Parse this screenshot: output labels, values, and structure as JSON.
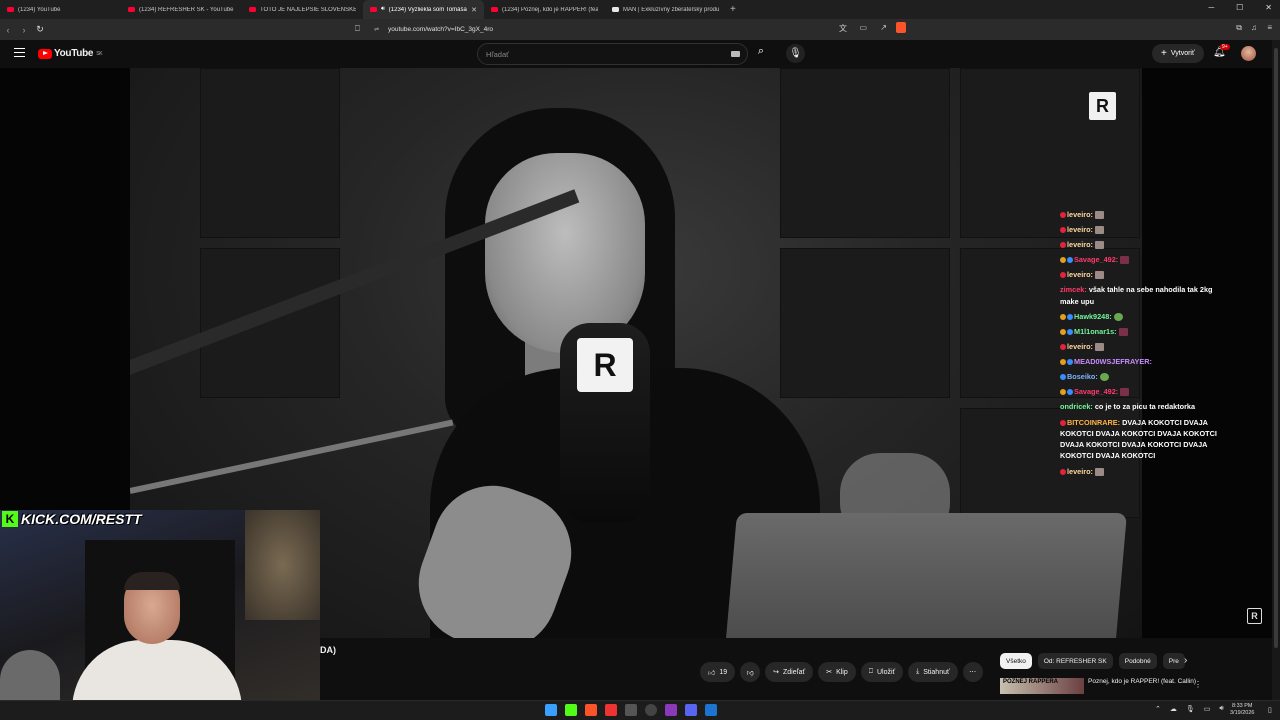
{
  "browser": {
    "tabs": [
      {
        "title": "(1234) YouTube",
        "fav": "youtube"
      },
      {
        "title": "(1234) REFRESHER SK - YouTube",
        "fav": "youtube"
      },
      {
        "title": "TOTO JE NAJLEPŠIE SLOVENSKÉ UMI",
        "fav": "youtube"
      },
      {
        "title": "(1234) Vyzliekla som Tomáša",
        "fav": "youtube",
        "active": true
      },
      {
        "title": "(1234) Poznej, kdo je RAPPER! (feat.",
        "fav": "youtube"
      },
      {
        "title": "MAN | Exkluzívny zberateľský produ",
        "fav": "page"
      }
    ],
    "url": "youtube.com/watch?v=IbC_3gX_4ro"
  },
  "youtube": {
    "logo": "YouTube",
    "region": "SK",
    "search_placeholder": "Hľadať",
    "create_label": "Vytvoriť",
    "notif_count": "9+"
  },
  "chat": [
    {
      "user": "leveiro:",
      "color": "#ffd8a0",
      "text": "",
      "emote": "gray",
      "badge": "red"
    },
    {
      "user": "leveiro:",
      "color": "#ffd8a0",
      "text": "",
      "emote": "gray",
      "badge": "red"
    },
    {
      "user": "leveiro:",
      "color": "#ffd8a0",
      "text": "",
      "emote": "gray",
      "badge": "red"
    },
    {
      "user": "Savage_492:",
      "color": "#ff3b6b",
      "text": "",
      "emote": "pink",
      "badge": "multi"
    },
    {
      "user": "leveiro:",
      "color": "#ffd8a0",
      "text": "",
      "emote": "gray",
      "badge": "red"
    },
    {
      "user": "zimcek:",
      "color": "#ff3b6b",
      "text": "však tahle na sebe nahodila tak 2kg make upu",
      "emote": "",
      "badge": ""
    },
    {
      "user": "Hawk9248:",
      "color": "#74f59a",
      "text": "",
      "emote": "green",
      "badge": "multi"
    },
    {
      "user": "M1l1onar1s:",
      "color": "#74f59a",
      "text": "",
      "emote": "pink",
      "badge": "multi"
    },
    {
      "user": "leveiro:",
      "color": "#ffd8a0",
      "text": "",
      "emote": "gray",
      "badge": "red"
    },
    {
      "user": "MEAD0WSJEFRAYER:",
      "color": "#c98cff",
      "text": "",
      "emote": "",
      "badge": "multi"
    },
    {
      "user": "Boseiko:",
      "color": "#7fb3ff",
      "text": "",
      "emote": "green",
      "badge": "blue"
    },
    {
      "user": "Savage_492:",
      "color": "#ff3b6b",
      "text": "",
      "emote": "pink",
      "badge": "multi"
    },
    {
      "user": "ondricek:",
      "color": "#74f59a",
      "text": "co je to za picu ta redaktorka",
      "emote": "",
      "badge": ""
    },
    {
      "user": "BITCOINRARE:",
      "color": "#ffb347",
      "text": "DVAJA KOKOTCI DVAJA KOKOTCI DVAJA KOKOTCI DVAJA KOKOTCI DVAJA KOKOTCI DVAJA KOKOTCI DVAJA KOKOTCI DVAJA KOKOTCI",
      "emote": "",
      "badge": "red"
    },
    {
      "user": "leveiro:",
      "color": "#ffd8a0",
      "text": "",
      "emote": "gray",
      "badge": "red"
    }
  ],
  "stream": {
    "kick_url": "KICK.COM/RESTT"
  },
  "video": {
    "title_fragment": "DA)",
    "likes": "19",
    "share_label": "Zdieľať",
    "clip_label": "Klip",
    "save_label": "Uložiť",
    "download_label": "Stiahnuť"
  },
  "chips": [
    "Všetko",
    "Od: REFRESHER SK",
    "Podobné",
    "Pre"
  ],
  "recommendation": {
    "thumb_text": "POZNEJ RAPPERA",
    "title": "Poznej, kdo je RAPPER! (feat. Callin)"
  },
  "taskbar": {
    "time": "8:33 PM",
    "date": "3/19/2026"
  }
}
